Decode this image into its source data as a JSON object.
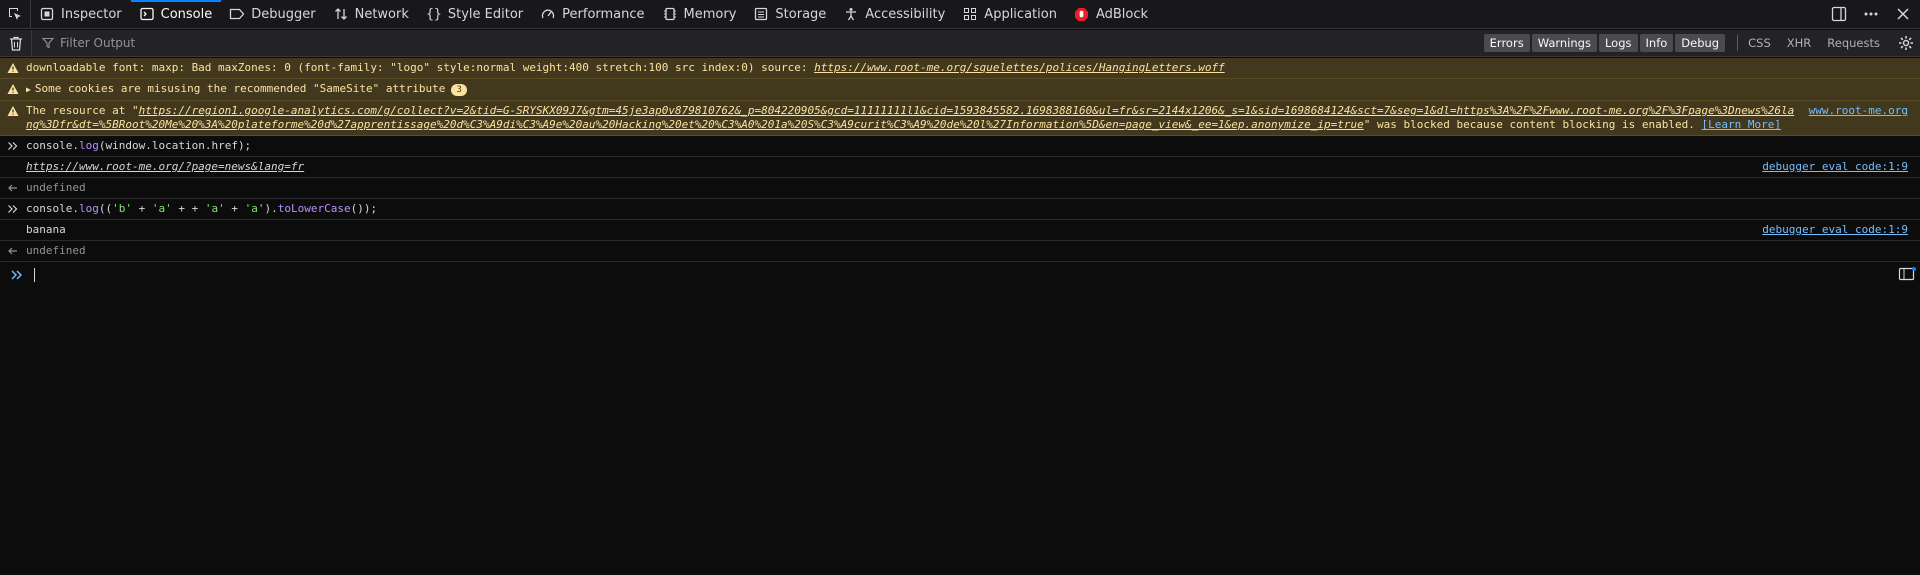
{
  "toolbar": {
    "tabs": [
      {
        "label": "Inspector",
        "icon": "inspector-icon"
      },
      {
        "label": "Console",
        "icon": "console-icon"
      },
      {
        "label": "Debugger",
        "icon": "debugger-icon"
      },
      {
        "label": "Network",
        "icon": "network-icon"
      },
      {
        "label": "Style Editor",
        "icon": "style-editor-icon"
      },
      {
        "label": "Performance",
        "icon": "performance-icon"
      },
      {
        "label": "Memory",
        "icon": "memory-icon"
      },
      {
        "label": "Storage",
        "icon": "storage-icon"
      },
      {
        "label": "Accessibility",
        "icon": "accessibility-icon"
      },
      {
        "label": "Application",
        "icon": "application-icon"
      },
      {
        "label": "AdBlock",
        "icon": "adblock-icon"
      }
    ],
    "selected": "Console",
    "accent": "#0a84ff"
  },
  "filterbar": {
    "placeholder": "Filter Output",
    "levels": [
      "Errors",
      "Warnings",
      "Logs",
      "Info",
      "Debug"
    ],
    "types": [
      "CSS",
      "XHR",
      "Requests"
    ]
  },
  "messages": {
    "font_warn": {
      "prefix": "downloadable font: maxp: Bad maxZones: 0 (font-family: \"logo\" style:normal weight:400 stretch:100 src index:0) source: ",
      "url": "https://www.root-me.org/squelettes/polices/HangingLetters.woff"
    },
    "samesite_warn": {
      "text": "Some cookies are misusing the recommended \"SameSite\" attribute",
      "count": "3"
    },
    "blocked_warn": {
      "prefix": "The resource at \"",
      "url": "https://region1.google-analytics.com/g/collect?v=2&tid=G-SRYSKX09J7&gtm=45je3ap0v879810762&_p=804220905&gcd=11111111l1&cid=1593845582.1698388160&ul=fr&sr=2144x1206&_s=1&sid=1698684124&sct=7&seg=1&dl=https%3A%2F%2Fwww.root-me.org%2F%3Fpage%3Dnews%26lang%3Dfr&dt=%5BRoot%20Me%20%3A%20plateforme%20d%27apprentissage%20d%C3%A9di%C3%A9e%20au%20Hacking%20et%20%C3%A0%201a%20S%C3%A9curit%C3%A9%20de%20l%27Information%5D&en=page_view&_ee=1&ep.anonymize_ip=true",
      "suffix": "\" was blocked because content blocking is enabled. ",
      "learn": "[Learn More]",
      "source": "www.root-me.org"
    },
    "cmd1": {
      "obj": "console",
      "fn": "log",
      "arg": "window.location.href",
      "tail": ");"
    },
    "log1": {
      "url": "https://www.root-me.org/?page=news&lang=fr",
      "source": "debugger eval code:1:9"
    },
    "res1": "undefined",
    "cmd2": {
      "obj": "console",
      "fn": "log",
      "s1": "'b'",
      "s2": "'a'",
      "s3": "'a'",
      "s4": "'a'",
      "method": "toLowerCase",
      "tail": "());"
    },
    "log2": {
      "text": "banana",
      "source": "debugger eval code:1:9"
    },
    "res2": "undefined"
  }
}
